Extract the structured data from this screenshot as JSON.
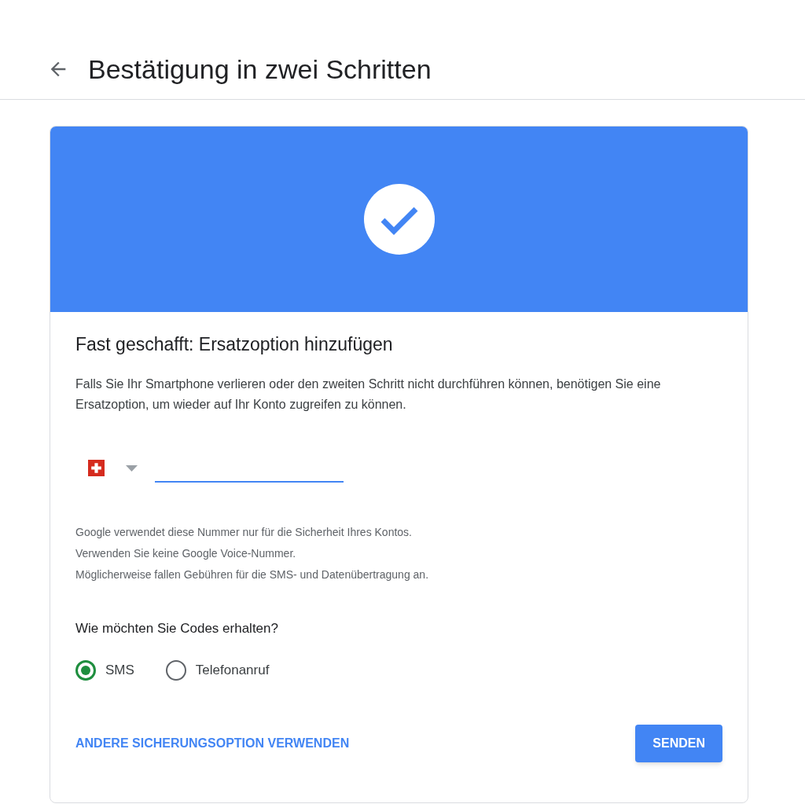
{
  "header": {
    "title": "Bestätigung in zwei Schritten"
  },
  "card": {
    "heading": "Fast geschafft: Ersatzoption hinzufügen",
    "description": "Falls Sie Ihr Smartphone verlieren oder den zweiten Schritt nicht durchführen können, benötigen Sie eine Ersatzoption, um wieder auf Ihr Konto zugreifen zu können.",
    "phone_field": {
      "focused": true
    },
    "notes": [
      "Google verwendet diese Nummer nur für die Sicherheit Ihres Kontos.",
      "Verwenden Sie keine Google Voice-Nummer.",
      "Möglicherweise fallen Gebühren für die SMS- und Datenübertragung an."
    ],
    "question": "Wie möchten Sie Codes erhalten?",
    "options": [
      {
        "label": "SMS",
        "selected": true
      },
      {
        "label": "Telefonanruf",
        "selected": false
      }
    ],
    "link": "ANDERE SICHERUNGSOPTION VERWENDEN",
    "button": "SENDEN"
  }
}
